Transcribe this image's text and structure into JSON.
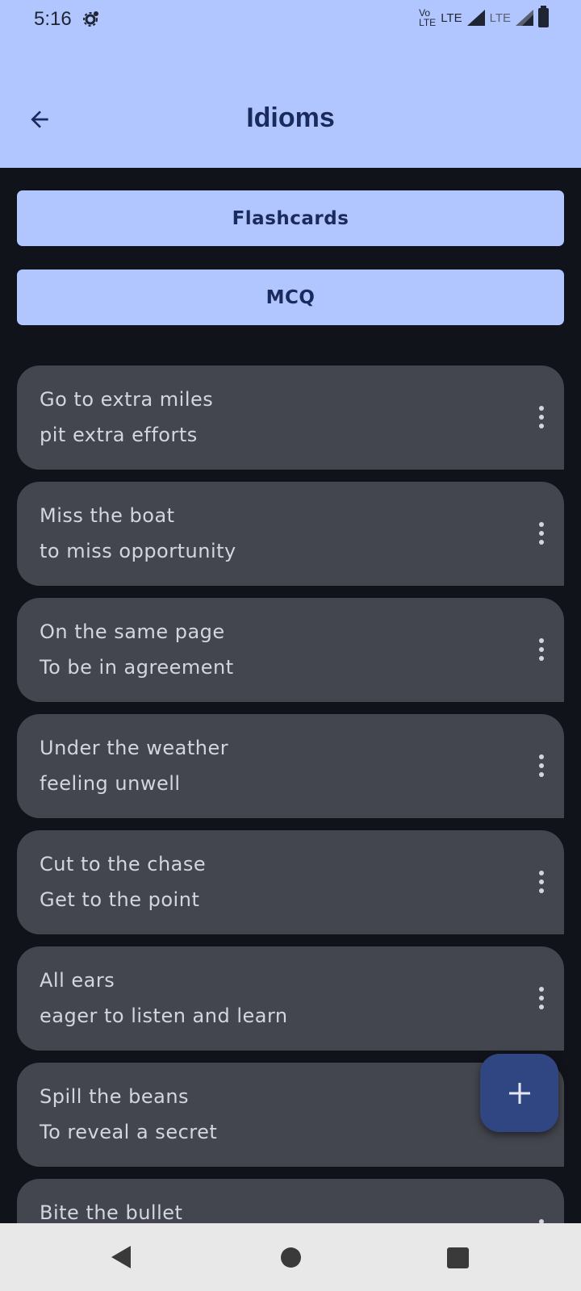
{
  "status_bar": {
    "time": "5:16",
    "volte_top": "Vo",
    "volte_bottom": "LTE",
    "network1": "LTE",
    "network2": "LTE"
  },
  "header": {
    "title": "Idioms",
    "back_icon": "arrow-back-icon"
  },
  "buttons": {
    "flashcards": "Flashcards",
    "mcq": "MCQ"
  },
  "idioms": [
    {
      "phrase": "Go to extra miles",
      "meaning": "pit extra efforts"
    },
    {
      "phrase": "Miss the boat",
      "meaning": "to miss opportunity"
    },
    {
      "phrase": "On the same page",
      "meaning": "To be in agreement"
    },
    {
      "phrase": "Under the weather",
      "meaning": "feeling unwell"
    },
    {
      "phrase": "Cut to the chase",
      "meaning": "Get to the point"
    },
    {
      "phrase": "All ears",
      "meaning": "eager to listen and learn"
    },
    {
      "phrase": "Spill the beans",
      "meaning": "To reveal a secret"
    },
    {
      "phrase": "Bite the bullet",
      "meaning": ""
    }
  ],
  "fab": {
    "icon": "plus-icon"
  },
  "colors": {
    "app_bar": "#b1c5ff",
    "background": "#11131a",
    "card": "#44464f",
    "title_text": "#1a2a5c",
    "fab": "#2f4682"
  }
}
